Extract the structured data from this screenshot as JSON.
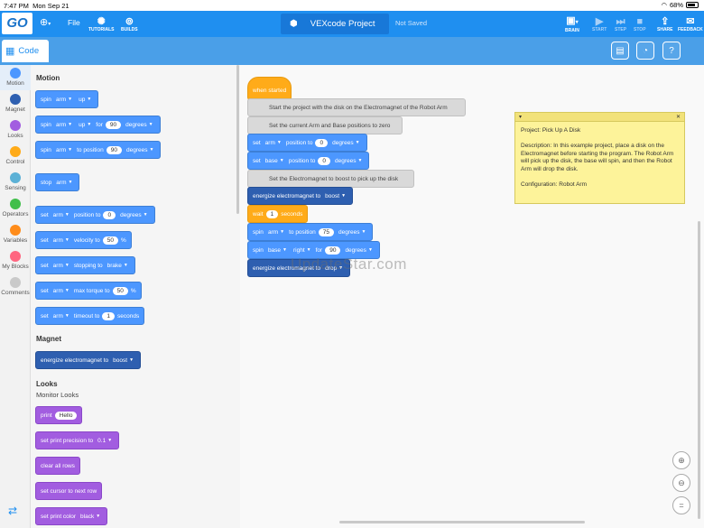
{
  "status_bar": {
    "time": "7:47 PM",
    "date": "Mon Sep 21",
    "battery": "68%"
  },
  "topbar": {
    "logo": "GO",
    "file_menu": "File",
    "tutorials": "TUTORIALS",
    "builds": "BUILDS",
    "project_name": "VEXcode Project",
    "save_status": "Not Saved",
    "brain": "BRAIN",
    "start": "START",
    "step": "STEP",
    "stop": "STOP",
    "share": "SHARE",
    "feedback": "FEEDBACK"
  },
  "secondary": {
    "code_tab": "Code"
  },
  "categories": [
    {
      "label": "Motion",
      "color": "#4c97ff"
    },
    {
      "label": "Magnet",
      "color": "#2e5fb0"
    },
    {
      "label": "Looks",
      "color": "#a25de0"
    },
    {
      "label": "Control",
      "color": "#ffab19"
    },
    {
      "label": "Sensing",
      "color": "#5cb1d6"
    },
    {
      "label": "Operators",
      "color": "#40bf4a"
    },
    {
      "label": "Variables",
      "color": "#ff8c1a"
    },
    {
      "label": "My Blocks",
      "color": "#ff6680"
    },
    {
      "label": "Comments",
      "color": "#c9c9c9"
    }
  ],
  "palette": {
    "motion_title": "Motion",
    "magnet_title": "Magnet",
    "looks_title": "Looks",
    "monitor_looks": "Monitor Looks",
    "b_spin": {
      "a": "spin",
      "b": "arm",
      "c": "up"
    },
    "b_spin_for": {
      "a": "spin",
      "b": "arm",
      "c": "up",
      "d": "for",
      "e": "90",
      "f": "degrees"
    },
    "b_spin_to": {
      "a": "spin",
      "b": "arm",
      "c": "to position",
      "d": "90",
      "e": "degrees"
    },
    "b_stop": {
      "a": "stop",
      "b": "arm"
    },
    "b_set_pos": {
      "a": "set",
      "b": "arm",
      "c": "position to",
      "d": "0",
      "e": "degrees"
    },
    "b_set_vel": {
      "a": "set",
      "b": "arm",
      "c": "velocity to",
      "d": "50",
      "e": "%"
    },
    "b_set_stop": {
      "a": "set",
      "b": "arm",
      "c": "stopping to",
      "d": "brake"
    },
    "b_set_torque": {
      "a": "set",
      "b": "arm",
      "c": "max torque to",
      "d": "50",
      "e": "%"
    },
    "b_set_timeout": {
      "a": "set",
      "b": "arm",
      "c": "timeout to",
      "d": "1",
      "e": "seconds"
    },
    "b_energize": {
      "a": "energize electromagnet to",
      "b": "boost"
    },
    "b_print": {
      "a": "print",
      "b": "Hello"
    },
    "b_precision": {
      "a": "set print precision to",
      "b": "0.1"
    },
    "b_clear": {
      "a": "clear all rows"
    },
    "b_cursor": {
      "a": "set cursor to next row"
    },
    "b_color": {
      "a": "set print color",
      "b": "black"
    }
  },
  "script": {
    "hat": "when started",
    "c1": "Start the project with the disk on the Electromagnet of the Robot Arm",
    "c2": "Set the current Arm and Base positions to zero",
    "s1": {
      "a": "set",
      "b": "arm",
      "c": "position to",
      "d": "0",
      "e": "degrees"
    },
    "s2": {
      "a": "set",
      "b": "base",
      "c": "position to",
      "d": "0",
      "e": "degrees"
    },
    "c3": "Set the Electromagnet to boost to pick up the disk",
    "s3": {
      "a": "energize electromagnet to",
      "b": "boost"
    },
    "s4": {
      "a": "wait",
      "b": "1",
      "c": "seconds"
    },
    "s5": {
      "a": "spin",
      "b": "arm",
      "c": "to position",
      "d": "75",
      "e": "degrees"
    },
    "s6": {
      "a": "spin",
      "b": "base",
      "c": "right",
      "d": "for",
      "e": "90",
      "f": "degrees"
    },
    "s7": {
      "a": "energize electromagnet to",
      "b": "drop"
    }
  },
  "note": {
    "title": "Project: Pick Up A Disk",
    "description": "Description: In this example project, place a disk on the Electromagnet before starting the program. The Robot Arm will pick up the disk, the base will spin, and then the Robot Arm will drop the disk.",
    "config": "Configuration: Robot Arm"
  },
  "watermark": "UpdateStar.com"
}
